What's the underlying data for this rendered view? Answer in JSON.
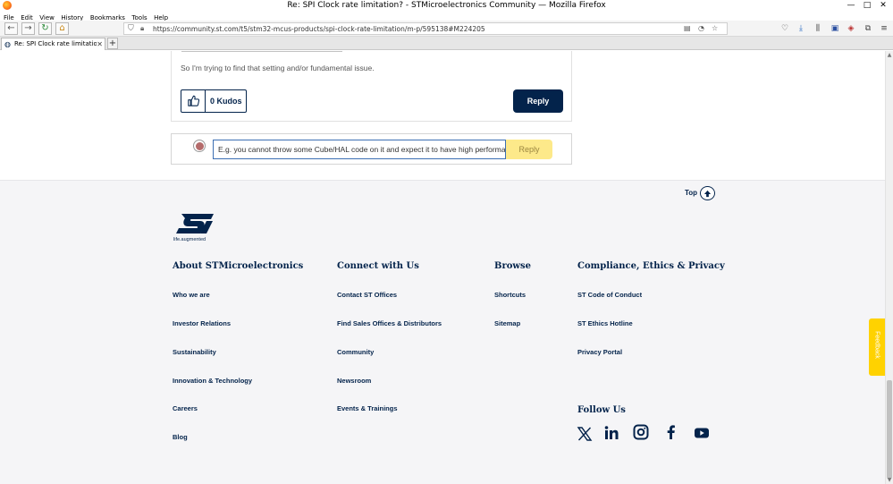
{
  "window": {
    "title": "Re: SPI Clock rate limitation? - STMicroelectronics Community — Mozilla Firefox",
    "minimize": "—",
    "maximize": "□",
    "close": "✕"
  },
  "menu": [
    "File",
    "Edit",
    "View",
    "History",
    "Bookmarks",
    "Tools",
    "Help"
  ],
  "navbar": {
    "url": "https://community.st.com/t5/stm32-mcus-products/spi-clock-rate-limitation/m-p/595138#M224205"
  },
  "tab": {
    "label": "Re: SPI Clock rate limitation? - ST",
    "close": "✕",
    "new_tab": "+"
  },
  "post": {
    "body_text": "So I'm trying to find that setting and/or fundamental issue.",
    "kudos_label": "0 Kudos",
    "reply_label": "Reply"
  },
  "reply_box": {
    "input_value": "E.g. you cannot throw some Cube/HAL code on it and expect it to have high performance",
    "reply_label": "Reply"
  },
  "footer": {
    "top_label": "Top",
    "logo_tagline": "life.augmented",
    "columns": [
      {
        "title": "About STMicroelectronics",
        "links": [
          "Who we are",
          "Investor Relations",
          "Sustainability",
          "Innovation & Technology",
          "Careers",
          "Blog"
        ]
      },
      {
        "title": "Connect with Us",
        "links": [
          "Contact ST Offices",
          "Find Sales Offices & Distributors",
          "Community",
          "Newsroom",
          "Events & Trainings"
        ]
      },
      {
        "title": "Browse",
        "links": [
          "Shortcuts",
          "Sitemap"
        ]
      },
      {
        "title": "Compliance, Ethics & Privacy",
        "links": [
          "ST Code of Conduct",
          "ST Ethics Hotline",
          "Privacy Portal"
        ]
      }
    ],
    "follow_title": "Follow Us",
    "social": [
      "x-icon",
      "linkedin-icon",
      "instagram-icon",
      "facebook-icon",
      "youtube-icon"
    ]
  },
  "feedback_label": "Feedback",
  "colors": {
    "brand_navy": "#03234b",
    "reply_yellow": "#fde98a",
    "feedback_yellow": "#ffd200"
  }
}
